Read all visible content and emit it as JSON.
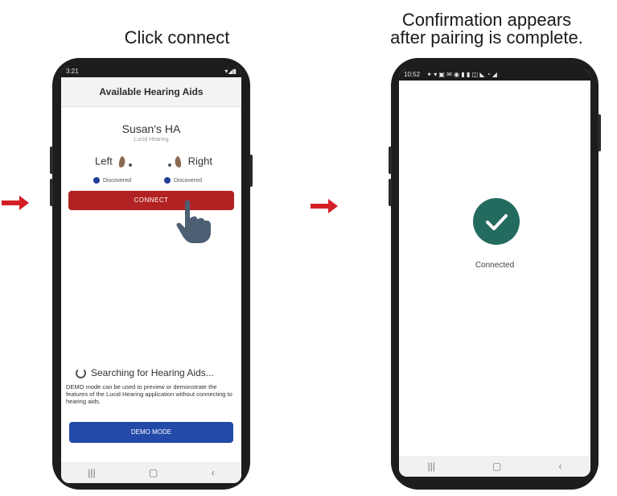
{
  "captions": {
    "left": "Click connect",
    "right_line1": "Confirmation appears",
    "right_line2": "after pairing is complete."
  },
  "left_phone": {
    "status_time": "3:21",
    "header_title": "Available Hearing Aids",
    "device_name": "Susan's HA",
    "device_brand": "Lucid Hearing",
    "left_label": "Left",
    "right_label": "Right",
    "left_status": "Discovered",
    "right_status": "Discovered",
    "connect_label": "CONNECT",
    "searching_text": "Searching for Hearing Aids...",
    "demo_text": "DEMO mode can be used to preview or demonstrate the features of the Lucid Hearing application without connecting to hearing aids.",
    "demo_button": "DEMO MODE"
  },
  "right_phone": {
    "status_time": "10:52",
    "connected_text": "Connected"
  },
  "colors": {
    "connect_red": "#b22222",
    "demo_blue": "#234aa8",
    "check_green": "#236b5f",
    "arrow_red": "#d32027"
  },
  "icons": [
    "arrow-right-icon",
    "hand-pointer-icon",
    "checkmark-icon",
    "spinner-icon",
    "hearing-aid-icon"
  ]
}
